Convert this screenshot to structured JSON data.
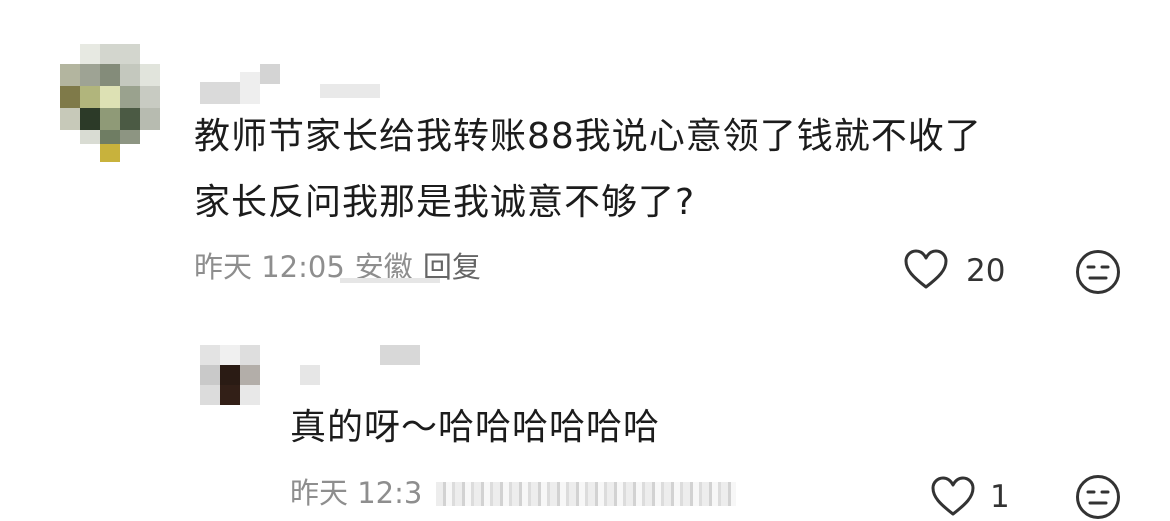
{
  "comments": [
    {
      "text_line1": "教师节家长给我转账88我说心意领了钱就不收了",
      "text_line2": "家长反问我那是我诚意不够了?",
      "time": "昨天 12:05",
      "location": "安徽",
      "reply_label": "回复",
      "like_count": "20",
      "like_icon": "heart-outline-icon",
      "emoji_icon": "expressionless-face-icon"
    },
    {
      "text": "真的呀～哈哈哈哈哈哈",
      "time": "昨天 12:3",
      "like_count": "1",
      "like_icon": "heart-outline-icon",
      "emoji_icon": "expressionless-face-icon"
    }
  ],
  "colors": {
    "text": "#1c1c1c",
    "meta": "#8e8e8e",
    "icon": "#333333"
  }
}
